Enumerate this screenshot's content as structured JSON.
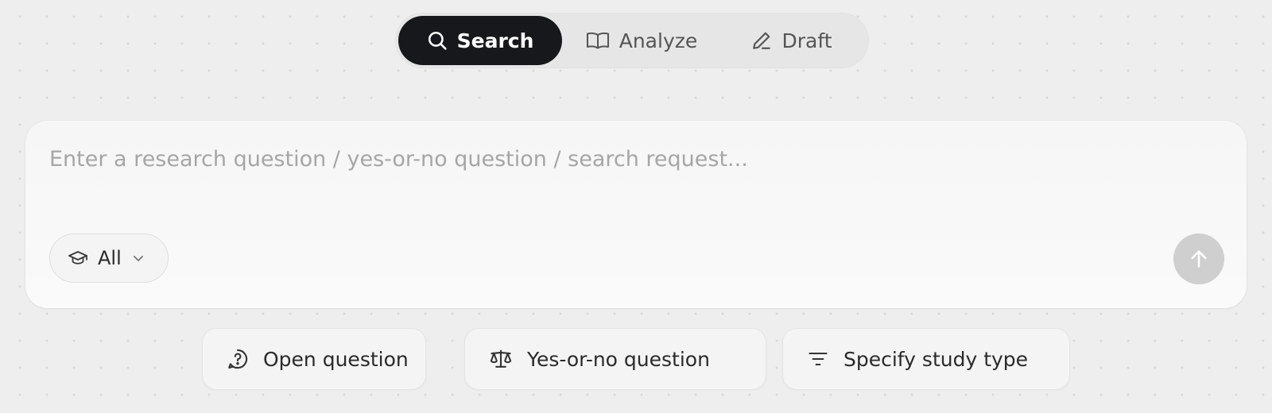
{
  "tabs": [
    {
      "label": "Search",
      "icon": "search-icon",
      "active": true
    },
    {
      "label": "Analyze",
      "icon": "book-icon",
      "active": false
    },
    {
      "label": "Draft",
      "icon": "pencil-icon",
      "active": false
    }
  ],
  "search": {
    "placeholder": "Enter a research question / yes-or-no question / search request...",
    "value": ""
  },
  "filter": {
    "label": "All",
    "icon": "graduation-cap-icon"
  },
  "submit": {
    "icon": "arrow-up-icon"
  },
  "suggestions": [
    {
      "label": "Open question",
      "icon": "question-bubble-icon"
    },
    {
      "label": "Yes-or-no question",
      "icon": "scale-icon"
    },
    {
      "label": "Specify study type",
      "icon": "filter-lines-icon"
    }
  ],
  "colors": {
    "active_tab_bg": "#16181b",
    "active_tab_text": "#ffffff",
    "inactive_tab_text": "#555555",
    "submit_bg": "#cfcfcf"
  }
}
